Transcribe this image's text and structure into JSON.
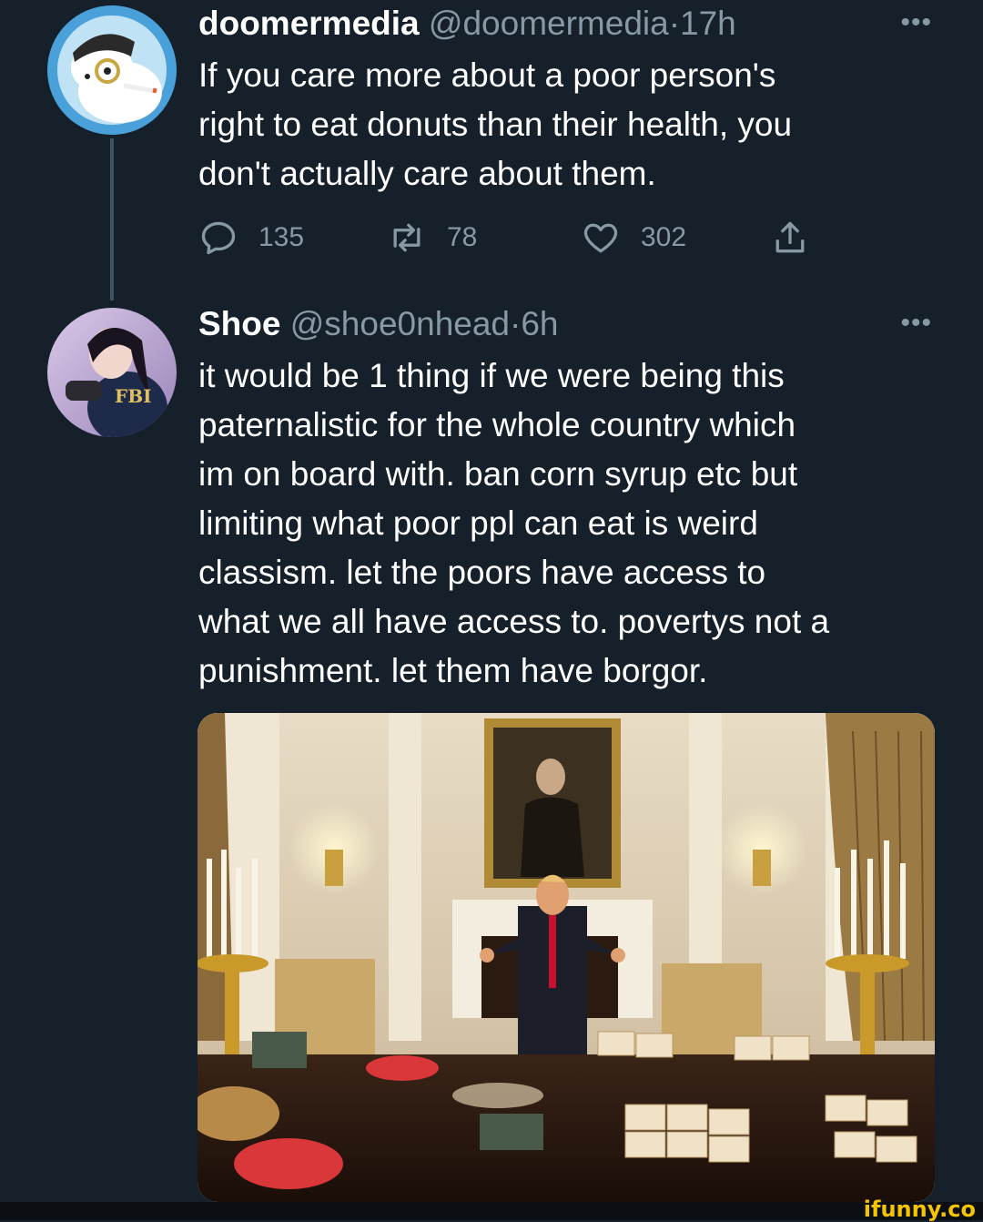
{
  "tweets": [
    {
      "name": "doomermedia",
      "handle": "@doomermedia",
      "separator": "·",
      "time": "17h",
      "more": "•••",
      "text": "If you care more about a poor person's\nright to eat donuts than their health, you\ndon't actually care about them.",
      "actions": {
        "replies": "135",
        "retweets": "78",
        "likes": "302"
      }
    },
    {
      "name": "Shoe",
      "handle": "@shoe0nhead",
      "separator": "·",
      "time": "6h",
      "more": "•••",
      "text": "it would be 1 thing if we were being this\npaternalistic for the whole country which\nim on board with. ban corn syrup etc but\nlimiting what poor ppl can eat is weird\nclassism. let the poors have access to\nwhat we all have access to. povertys not a\npunishment. let them have borgor."
    }
  ],
  "watermark": "ifunny.co",
  "colors": {
    "background": "#15202b",
    "text": "#ffffff",
    "muted": "#8899a6",
    "thread_line": "#3d5466",
    "watermark": "#f5c400"
  }
}
